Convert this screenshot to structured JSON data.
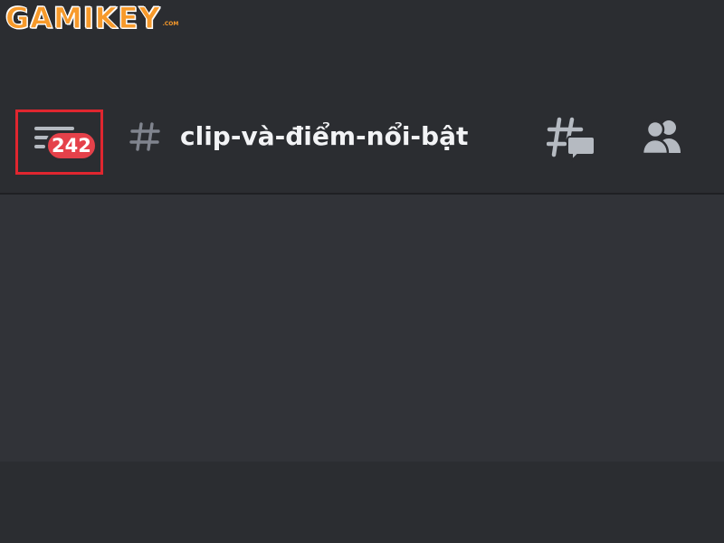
{
  "watermark": {
    "brand": "GAMIKEY",
    "suffix": ".COM",
    "color": "#f79a2b"
  },
  "header": {
    "menu_icon": "hamburger-menu-icon",
    "unread_badge": "242",
    "badge_color": "#e5414a",
    "highlight_color": "#e0262f",
    "channel_icon": "hash-icon",
    "channel_name": "clip-và-điểm-nổi-bật",
    "actions": [
      {
        "icon": "threads-icon"
      },
      {
        "icon": "members-icon"
      }
    ]
  },
  "colors": {
    "header_bg": "#2b2d31",
    "content_bg": "#313338",
    "icon_gray": "#b5bac1",
    "text": "#f2f3f5"
  }
}
